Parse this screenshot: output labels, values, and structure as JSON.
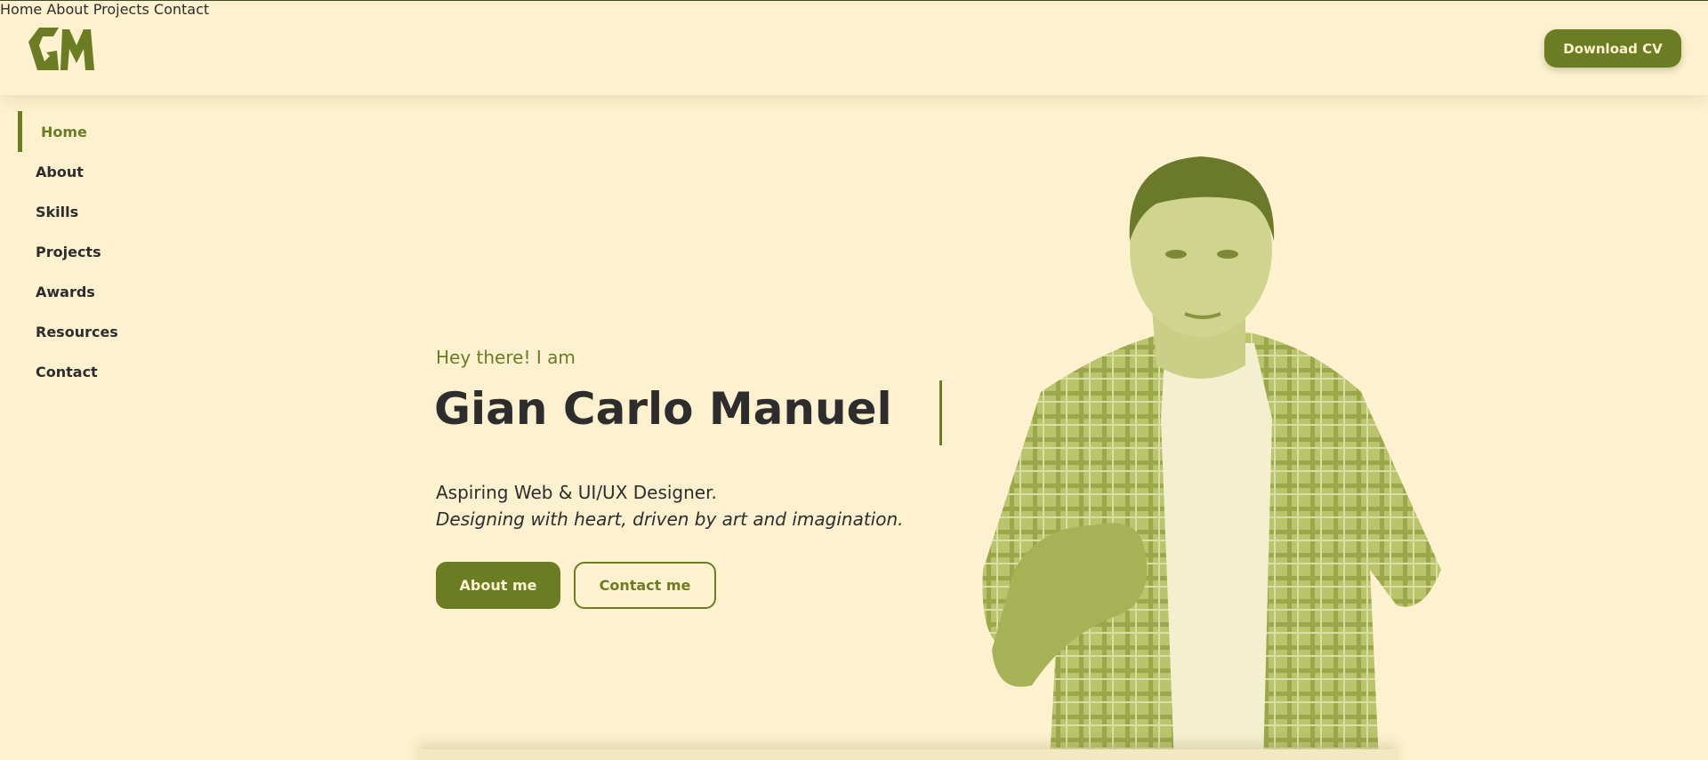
{
  "logo": {
    "alt": "GM logo"
  },
  "nav": {
    "items": [
      {
        "label": "Home"
      },
      {
        "label": "About"
      },
      {
        "label": "Projects"
      },
      {
        "label": "Contact"
      }
    ],
    "cv_label": "Download CV"
  },
  "sidebar": {
    "items": [
      {
        "label": "Home",
        "active": true
      },
      {
        "label": "About",
        "active": false
      },
      {
        "label": "Skills",
        "active": false
      },
      {
        "label": "Projects",
        "active": false
      },
      {
        "label": "Awards",
        "active": false
      },
      {
        "label": "Resources",
        "active": false
      },
      {
        "label": "Contact",
        "active": false
      }
    ]
  },
  "hero": {
    "greeting": "Hey there! I am",
    "name": "Gian Carlo Manuel",
    "description": "Aspiring Web & UI/UX Designer.",
    "tagline": "Designing with heart, driven by art and imagination.",
    "about_button": "About me",
    "contact_button": "Contact me"
  },
  "colors": {
    "background": "#fdf1cf",
    "accent": "#6b7d23",
    "text": "#2d2d2d"
  }
}
